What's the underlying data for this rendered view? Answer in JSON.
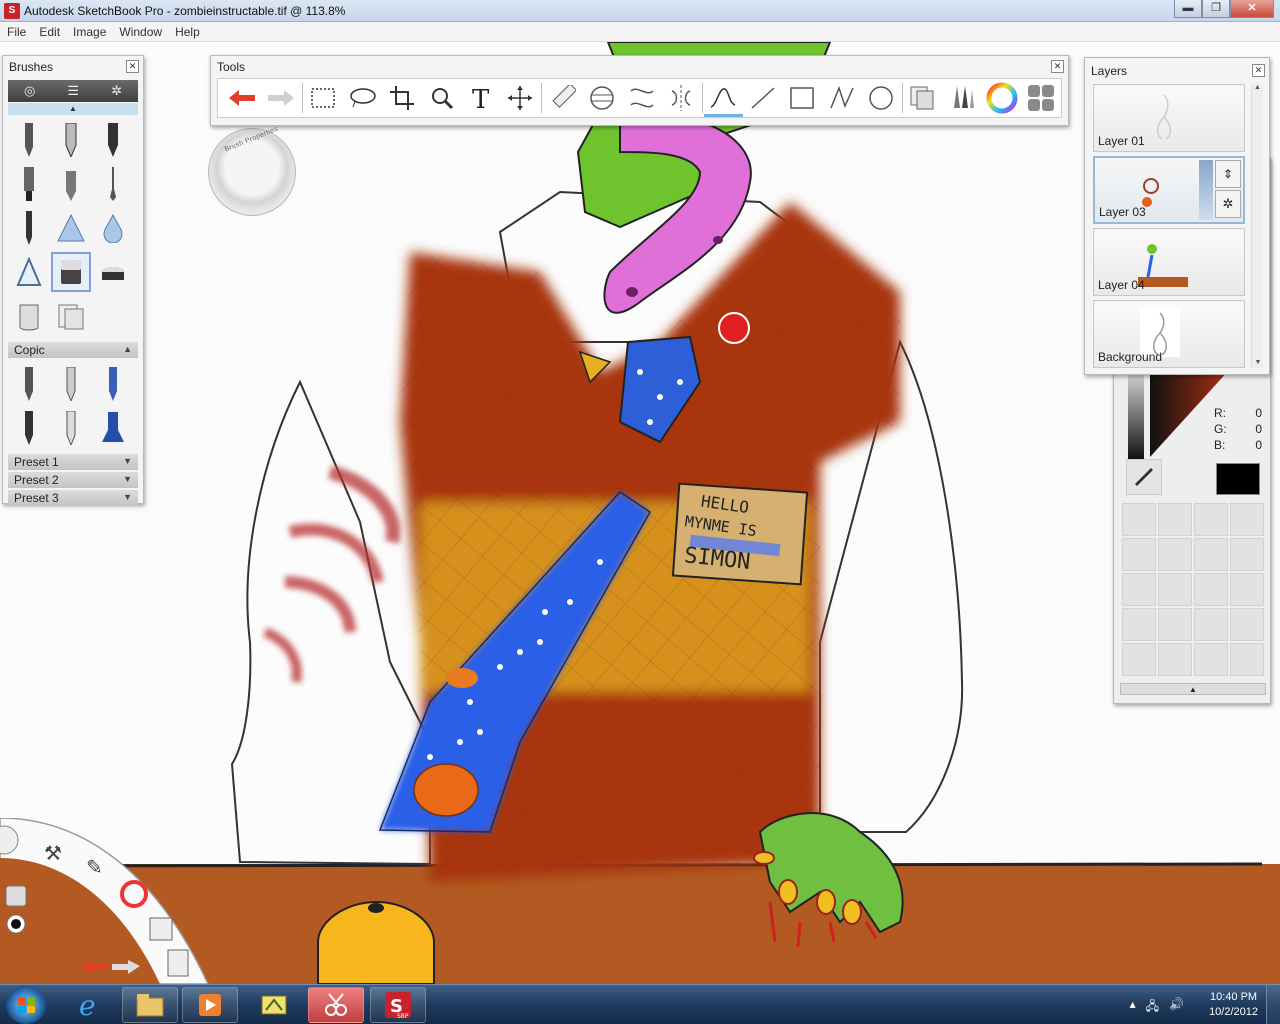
{
  "window": {
    "title": "Autodesk SketchBook Pro - zombieinstructable.tif @ 113.8%",
    "minimize": "▬",
    "maximize": "❐",
    "close": "✕"
  },
  "menu": [
    "File",
    "Edit",
    "Image",
    "Window",
    "Help"
  ],
  "brushes_panel": {
    "title": "Brushes",
    "close": "✕",
    "section_copic": "Copic",
    "presets": [
      "Preset 1",
      "Preset 2",
      "Preset 3"
    ]
  },
  "tools_panel": {
    "title": "Tools",
    "close": "✕"
  },
  "brush_properties": {
    "label": "Brush Properties"
  },
  "layers_panel": {
    "title": "Layers",
    "close": "✕",
    "layers": [
      "Layer 01",
      "Layer 03",
      "Layer 04",
      "Background"
    ]
  },
  "color_panel": {
    "r_label": "R:",
    "g_label": "G:",
    "b_label": "B:",
    "r": "0",
    "g": "0",
    "b": "0",
    "current_color": "#000000"
  },
  "artwork": {
    "nametag_line1": "HELLO",
    "nametag_line2": "MYNME IS",
    "nametag_line3": "SIMON"
  },
  "taskbar": {
    "time": "10:40 PM",
    "date": "10/2/2012",
    "sbp_label": "SBP"
  }
}
